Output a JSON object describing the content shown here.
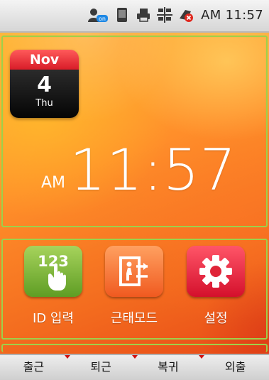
{
  "status_bar": {
    "icons": [
      "user-online-icon",
      "phone-icon",
      "printer-icon",
      "network-icon",
      "sync-error-icon"
    ],
    "user_badge": "on",
    "time": "AM 11:57"
  },
  "calendar": {
    "month": "Nov",
    "day": "4",
    "weekday": "Thu"
  },
  "clock": {
    "ampm": "AM",
    "time": "11:57"
  },
  "buttons": [
    {
      "label": "ID 입력",
      "icon": "keypad-123-icon",
      "tile_text": "123",
      "color": "#7cb83a"
    },
    {
      "label": "근태모드",
      "icon": "door-exit-icon",
      "color": "#f4722e"
    },
    {
      "label": "설정",
      "icon": "gear-icon",
      "color": "#e8283c"
    }
  ],
  "tabs": [
    "출근",
    "퇴근",
    "복귀",
    "외출"
  ],
  "colors": {
    "accent_frame": "#9ed04a",
    "tab_marker": "#d01010"
  }
}
